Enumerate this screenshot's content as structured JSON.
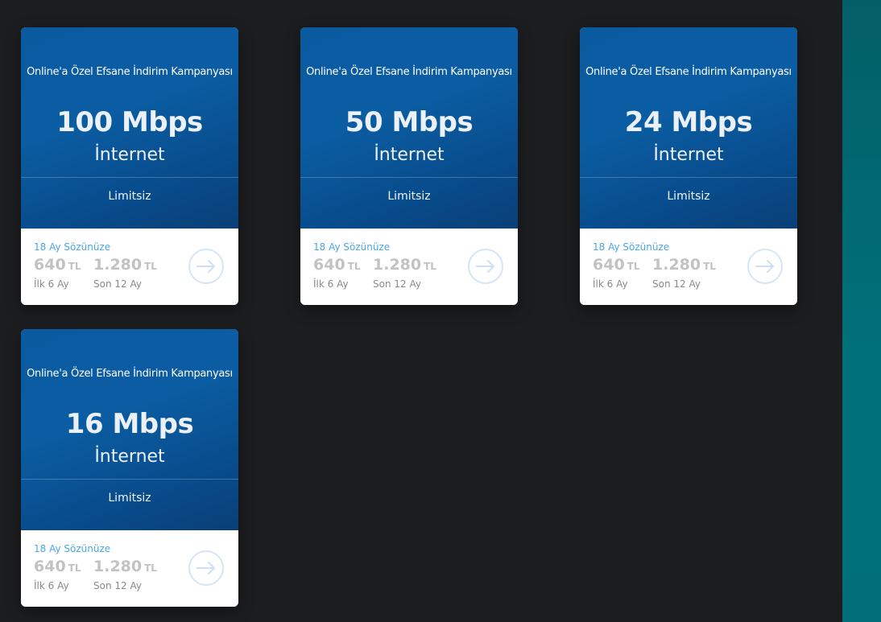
{
  "colors": {
    "card_top": "#0b5da3",
    "contract_text": "#4aa6e6",
    "price_text": "#c2c2c2",
    "arrow_ring": "#d6e4f6",
    "background": "#1c1d1f",
    "side_strip": "#00717b"
  },
  "cards": [
    {
      "campaign": "Online'a Özel Efsane İndirim Kampanyası",
      "speed": "100 Mbps",
      "product": "İnternet",
      "quota": "Limitsiz",
      "contract": "18 Ay Sözünüze",
      "price_first": "640",
      "price_rest": "1.280",
      "currency": "TL",
      "period_first": "İlk 6 Ay",
      "period_rest": "Son 12 Ay",
      "arrow_icon": "arrow-right-icon"
    },
    {
      "campaign": "Online'a Özel Efsane İndirim Kampanyası",
      "speed": "50 Mbps",
      "product": "İnternet",
      "quota": "Limitsiz",
      "contract": "18 Ay Sözünüze",
      "price_first": "640",
      "price_rest": "1.280",
      "currency": "TL",
      "period_first": "İlk 6 Ay",
      "period_rest": "Son 12 Ay",
      "arrow_icon": "arrow-right-icon"
    },
    {
      "campaign": "Online'a Özel Efsane İndirim Kampanyası",
      "speed": "24 Mbps",
      "product": "İnternet",
      "quota": "Limitsiz",
      "contract": "18 Ay Sözünüze",
      "price_first": "640",
      "price_rest": "1.280",
      "currency": "TL",
      "period_first": "İlk 6 Ay",
      "period_rest": "Son 12 Ay",
      "arrow_icon": "arrow-right-icon"
    },
    {
      "campaign": "Online'a Özel Efsane İndirim Kampanyası",
      "speed": "16 Mbps",
      "product": "İnternet",
      "quota": "Limitsiz",
      "contract": "18 Ay Sözünüze",
      "price_first": "640",
      "price_rest": "1.280",
      "currency": "TL",
      "period_first": "İlk 6 Ay",
      "period_rest": "Son 12 Ay",
      "arrow_icon": "arrow-right-icon"
    }
  ]
}
